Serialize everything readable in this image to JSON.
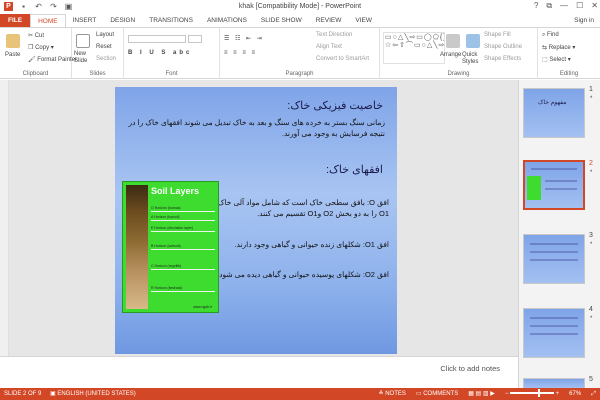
{
  "titlebar": {
    "title": "khak [Compatibility Mode] - PowerPoint",
    "logo": "P",
    "window_controls": [
      "?",
      "⧉",
      "—",
      "☐",
      "✕"
    ]
  },
  "tabs": [
    "FILE",
    "HOME",
    "INSERT",
    "DESIGN",
    "TRANSITIONS",
    "ANIMATIONS",
    "SLIDE SHOW",
    "REVIEW",
    "VIEW"
  ],
  "signin": "Sign in",
  "ribbon": {
    "clipboard": {
      "label": "Clipboard",
      "paste": "Paste",
      "cut": "Cut",
      "copy": "Copy",
      "format_painter": "Format Painter"
    },
    "slides": {
      "label": "Slides",
      "new_slide": "New Slide",
      "layout": "Layout",
      "reset": "Reset",
      "section": "Section"
    },
    "font": {
      "label": "Font"
    },
    "paragraph": {
      "label": "Paragraph",
      "text_direction": "Text Direction",
      "align_text": "Align Text",
      "convert_smartart": "Convert to SmartArt"
    },
    "drawing": {
      "label": "Drawing",
      "arrange": "Arrange",
      "quick_styles": "Quick Styles",
      "shape_fill": "Shape Fill",
      "shape_outline": "Shape Outline",
      "shape_effects": "Shape Effects"
    },
    "editing": {
      "label": "Editing",
      "find": "Find",
      "replace": "Replace",
      "select": "Select"
    }
  },
  "slide": {
    "heading1": "خاصیت فیزیکی خاک:",
    "para1": "زمانی سنگ بستر به خرده های سنگ و بعد به خاک تبدیل می شوند افقهای خاک را در نتیجه فرسایش به وجود می آورند.",
    "heading2": "افقهای خاک:",
    "b1": "افق O: بافق سطحی خاک است که شامل مواد آلی خاک O1 را به دو بخش O2 وO1 تقسیم می کنند.",
    "b2": "افق O1: شکلهای زنده حیوانی و گیاهی وجود دارند.",
    "b3": "افق O2: شکلهای پوسیده حیوانی و گیاهی دیده می شود.",
    "soil_image": {
      "title": "Soil Layers",
      "rows": [
        "O Horizon (humus)",
        "A Horizon (topsoil)",
        "E Horizon (eluviation layer)",
        "B Horizon (subsoil)",
        "C Horizon (regolith)",
        "R Horizon (bedrock)"
      ],
      "url": "www.ngdir.ir"
    }
  },
  "notes": {
    "placeholder": "Click to add notes"
  },
  "thumbnails": [
    {
      "num": "1",
      "star": "*",
      "title": "مفهوم خاک"
    },
    {
      "num": "2",
      "star": "*"
    },
    {
      "num": "3",
      "star": "*"
    },
    {
      "num": "4",
      "star": "*"
    },
    {
      "num": "5"
    }
  ],
  "status": {
    "slide": "SLIDE 2 OF 9",
    "lang": "ENGLISH (UNITED STATES)",
    "notes": "NOTES",
    "comments": "COMMENTS",
    "zoom": "67%"
  }
}
